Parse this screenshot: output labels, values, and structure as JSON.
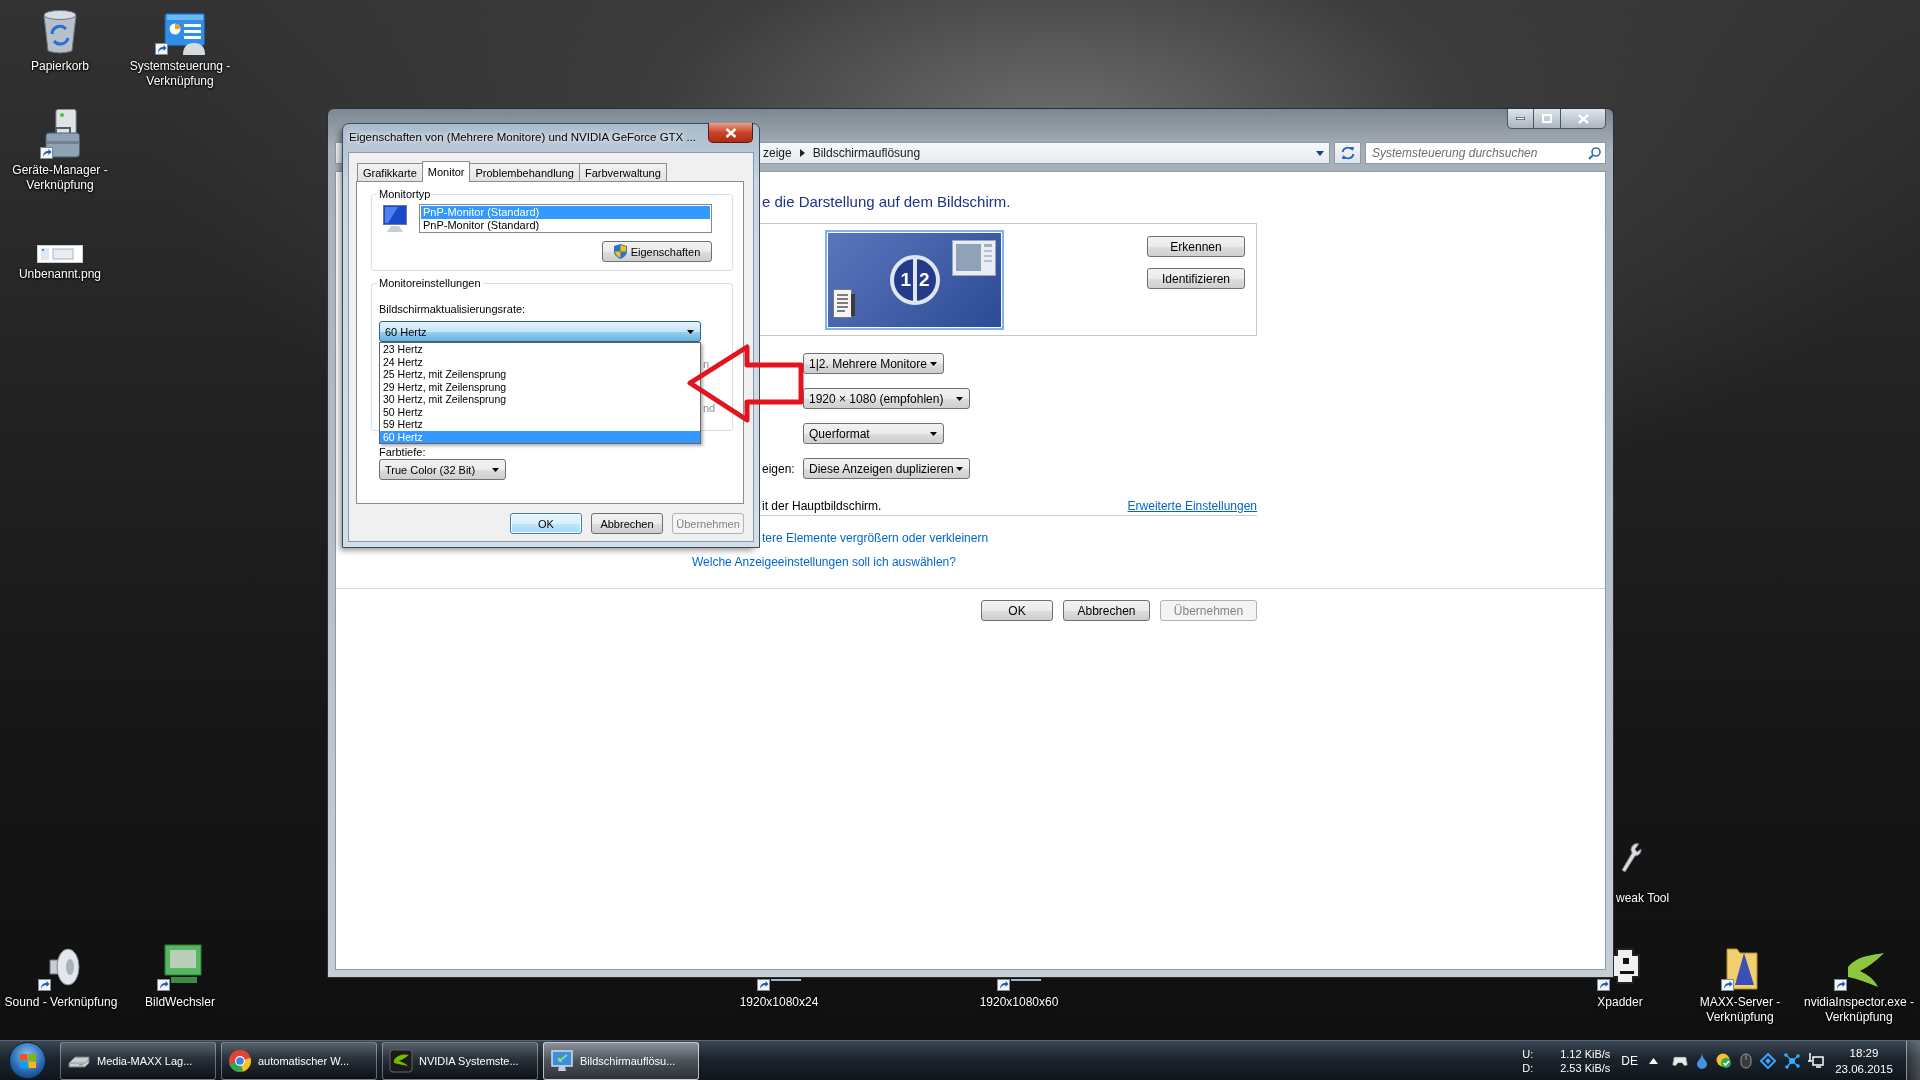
{
  "desktop": {
    "icons": [
      {
        "label": "Papierkorb",
        "kind": "recycle-bin",
        "shortcut": false
      },
      {
        "label": "Systemsteuerung - Verknüpfung",
        "kind": "control-panel",
        "shortcut": true
      },
      {
        "label": "Geräte-Manager - Verknüpfung",
        "kind": "device-manager",
        "shortcut": true
      },
      {
        "label": "Unbenannt.png",
        "kind": "image",
        "shortcut": false
      },
      {
        "label": "Sound - Verknüpfung",
        "kind": "speaker",
        "shortcut": true
      },
      {
        "label": "BildWechsler",
        "kind": "picture-changer",
        "shortcut": true
      },
      {
        "label": "1920x1080x24",
        "kind": "covered",
        "shortcut": true
      },
      {
        "label": "1920x1080x60",
        "kind": "covered",
        "shortcut": true
      },
      {
        "label": "weak Tool",
        "kind": "wrench",
        "shortcut": false
      },
      {
        "label": "Xpadder",
        "kind": "gamepad",
        "shortcut": true
      },
      {
        "label": "MAXX-Server - Verknüpfung",
        "kind": "folder",
        "shortcut": true
      },
      {
        "label": "nvidiaInspector.exe - Verknüpfung",
        "kind": "nvidia",
        "shortcut": true
      }
    ]
  },
  "main_window": {
    "breadcrumb": [
      "zeige",
      "Bildschirmauflösung"
    ],
    "search": {
      "placeholder": "Systemsteuerung durchsuchen"
    },
    "heading": "e die Darstellung auf dem Bildschirm.",
    "display_numbers": [
      "1",
      "2"
    ],
    "display_buttons": [
      "Erkennen",
      "Identifizieren"
    ],
    "settings": [
      {
        "value": "1|2. Mehrere Monitore"
      },
      {
        "value": "1920 × 1080 (empfohlen)"
      },
      {
        "value": "Querformat"
      },
      {
        "label": "eigen:",
        "value": "Diese Anzeigen duplizieren"
      }
    ],
    "note": "it der Hauptbildschirm.",
    "advanced_link": "Erweiterte Einstellungen",
    "links": [
      "tere Elemente vergrößern oder verkleinern",
      "Welche Anzeigeeinstellungen soll ich auswählen?"
    ],
    "buttons": [
      {
        "label": "OK",
        "disabled": false
      },
      {
        "label": "Abbrechen",
        "disabled": false
      },
      {
        "label": "Übernehmen",
        "disabled": true
      }
    ]
  },
  "dialog": {
    "title": "Eigenschaften von (Mehrere Monitore) und NVIDIA GeForce GTX ...",
    "tabs": [
      {
        "label": "Grafikkarte",
        "selected": false
      },
      {
        "label": "Monitor",
        "selected": true
      },
      {
        "label": "Problembehandlung",
        "selected": false
      },
      {
        "label": "Farbverwaltung",
        "selected": false
      }
    ],
    "monitor_type": {
      "legend": "Monitortyp",
      "monitors": [
        {
          "label": "PnP-Monitor (Standard)",
          "selected": true
        },
        {
          "label": "PnP-Monitor (Standard)",
          "selected": false
        }
      ],
      "properties_button": "Eigenschaften"
    },
    "monitor_settings": {
      "legend": "Monitoreinstellungen",
      "refresh_label": "Bildschirmaktualisierungsrate:",
      "refresh_rate": {
        "value": "60 Hertz",
        "expanded": true,
        "options": [
          {
            "label": "23 Hertz",
            "selected": false
          },
          {
            "label": "24 Hertz",
            "selected": false
          },
          {
            "label": "25 Hertz, mit Zeilensprung",
            "selected": false
          },
          {
            "label": "29 Hertz, mit Zeilensprung",
            "selected": false
          },
          {
            "label": "30 Hertz, mit Zeilensprung",
            "selected": false
          },
          {
            "label": "50 Hertz",
            "selected": false
          },
          {
            "label": "59 Hertz",
            "selected": false
          },
          {
            "label": "60 Hertz",
            "selected": true
          }
        ]
      },
      "covered_fragments": [
        "n",
        "nd"
      ]
    },
    "color_depth": {
      "label": "Farbtiefe:",
      "value": "True Color (32 Bit)"
    },
    "buttons": [
      {
        "label": "OK",
        "default": true,
        "disabled": false
      },
      {
        "label": "Abbrechen",
        "default": false,
        "disabled": false
      },
      {
        "label": "Übernehmen",
        "default": false,
        "disabled": true
      }
    ]
  },
  "taskbar": {
    "buttons": [
      {
        "label": "Media-MAXX Lag...",
        "kind": "drive",
        "selected": false
      },
      {
        "label": "automatischer W...",
        "kind": "browser",
        "selected": false
      },
      {
        "label": "NVIDIA Systemste...",
        "kind": "nvidia",
        "selected": false
      },
      {
        "label": "Bildschirmauflösu...",
        "kind": "display",
        "selected": true
      }
    ],
    "network": [
      {
        "label": "U:",
        "rate": "1.12 KiB/s"
      },
      {
        "label": "D:",
        "rate": "2.53 KiB/s"
      }
    ],
    "language": "DE",
    "time": "18:29",
    "date": "23.06.2015"
  }
}
